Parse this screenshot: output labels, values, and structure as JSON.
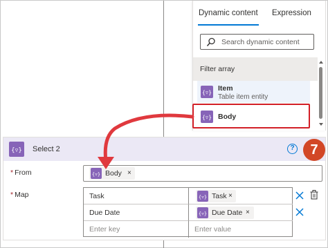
{
  "dynamic_panel": {
    "tabs": [
      "Dynamic content",
      "Expression"
    ],
    "search_placeholder": "Search dynamic content",
    "section_label": "Filter array",
    "items": [
      {
        "title": "Item",
        "subtitle": "Table item entity"
      },
      {
        "title": "Body",
        "subtitle": ""
      }
    ]
  },
  "card": {
    "title": "Select 2",
    "help": "?",
    "step_number": "7",
    "from_label": "From",
    "from_token": "Body",
    "map_label": "Map",
    "required_mark": "*",
    "remove_glyph": "×",
    "rows": [
      {
        "key": "Task",
        "value": "Task"
      },
      {
        "key": "Due Date",
        "value": "Due Date"
      }
    ],
    "key_placeholder": "Enter key",
    "value_placeholder": "Enter value"
  },
  "colors": {
    "accent": "#0078d4",
    "token_purple": "#8764b8",
    "highlight_red": "#d21f26",
    "badge_orange": "#d24726"
  }
}
